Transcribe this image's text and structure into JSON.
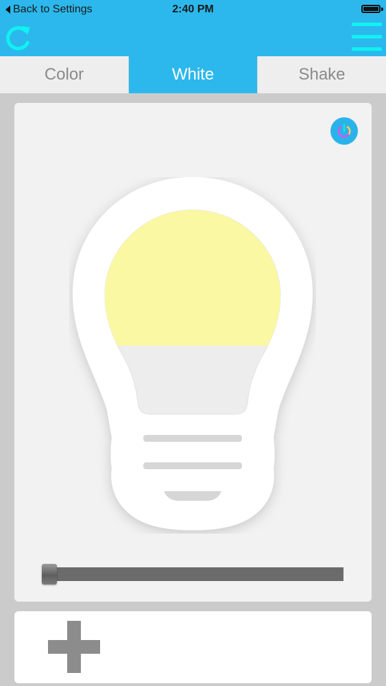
{
  "status_bar": {
    "back_label": "Back to Settings",
    "time": "2:40 PM"
  },
  "header": {
    "refresh_icon": "refresh-icon",
    "menu_icon": "hamburger-menu-icon",
    "accent_color": "#2cb8ec"
  },
  "tabs": [
    {
      "label": "Color",
      "active": false
    },
    {
      "label": "White",
      "active": true
    },
    {
      "label": "Shake",
      "active": false
    }
  ],
  "controls": {
    "power_icon": "power-icon",
    "bulb_glow_color": "#fbf8a4",
    "brightness_level": 0
  },
  "add_card": {
    "add_icon": "plus-icon"
  }
}
